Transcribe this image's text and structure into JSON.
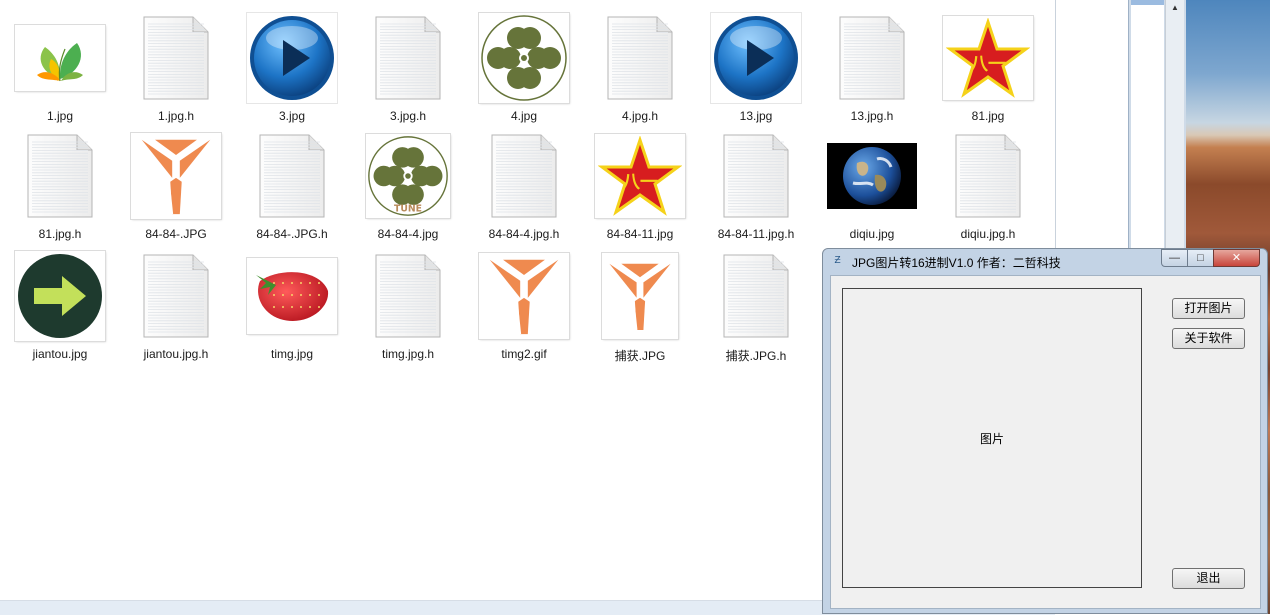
{
  "files": [
    {
      "name": "1.jpg",
      "icon": "leaf-logo-icon"
    },
    {
      "name": "1.jpg.h",
      "icon": "document-icon"
    },
    {
      "name": "3.jpg",
      "icon": "play-orb-icon"
    },
    {
      "name": "3.jpg.h",
      "icon": "document-icon"
    },
    {
      "name": "4.jpg",
      "icon": "clover-icon"
    },
    {
      "name": "4.jpg.h",
      "icon": "document-icon"
    },
    {
      "name": "13.jpg",
      "icon": "play-orb-icon"
    },
    {
      "name": "13.jpg.h",
      "icon": "document-icon"
    },
    {
      "name": "81.jpg",
      "icon": "red-star-icon"
    },
    {
      "name": "81.jpg.h",
      "icon": "document-icon"
    },
    {
      "name": "84-84-.JPG",
      "icon": "orange-logo-icon"
    },
    {
      "name": "84-84-.JPG.h",
      "icon": "document-icon"
    },
    {
      "name": "84-84-4.jpg",
      "icon": "clover-tune-icon"
    },
    {
      "name": "84-84-4.jpg.h",
      "icon": "document-icon"
    },
    {
      "name": "84-84-11.jpg",
      "icon": "red-star-icon"
    },
    {
      "name": "84-84-11.jpg.h",
      "icon": "document-icon"
    },
    {
      "name": "diqiu.jpg",
      "icon": "earth-icon"
    },
    {
      "name": "diqiu.jpg.h",
      "icon": "document-icon"
    },
    {
      "name": "jiantou.jpg",
      "icon": "arrow-icon"
    },
    {
      "name": "jiantou.jpg.h",
      "icon": "document-icon"
    },
    {
      "name": "timg.jpg",
      "icon": "strawberry-icon"
    },
    {
      "name": "timg.jpg.h",
      "icon": "document-icon"
    },
    {
      "name": "timg2.gif",
      "icon": "orange-logo-icon"
    },
    {
      "name": "捕获.JPG",
      "icon": "orange-logo-icon"
    },
    {
      "name": "捕获.JPG.h",
      "icon": "document-icon"
    }
  ],
  "tune_text": "TUNE",
  "star_char": "八一",
  "dialog": {
    "title": "JPG图片转16进制V1.0 作者：二哲科技",
    "picture_label": "图片",
    "open_button": "打开图片",
    "about_button": "关于软件",
    "exit_button": "退出",
    "close_glyph": "✕",
    "max_glyph": "□",
    "min_glyph": "—"
  },
  "colors": {
    "orange_logo": "#ef8a4f",
    "clover": "#66743a",
    "star_red": "#d71d1f",
    "star_yellow": "#f5d21a",
    "orb_blue": "#1d74c6"
  }
}
